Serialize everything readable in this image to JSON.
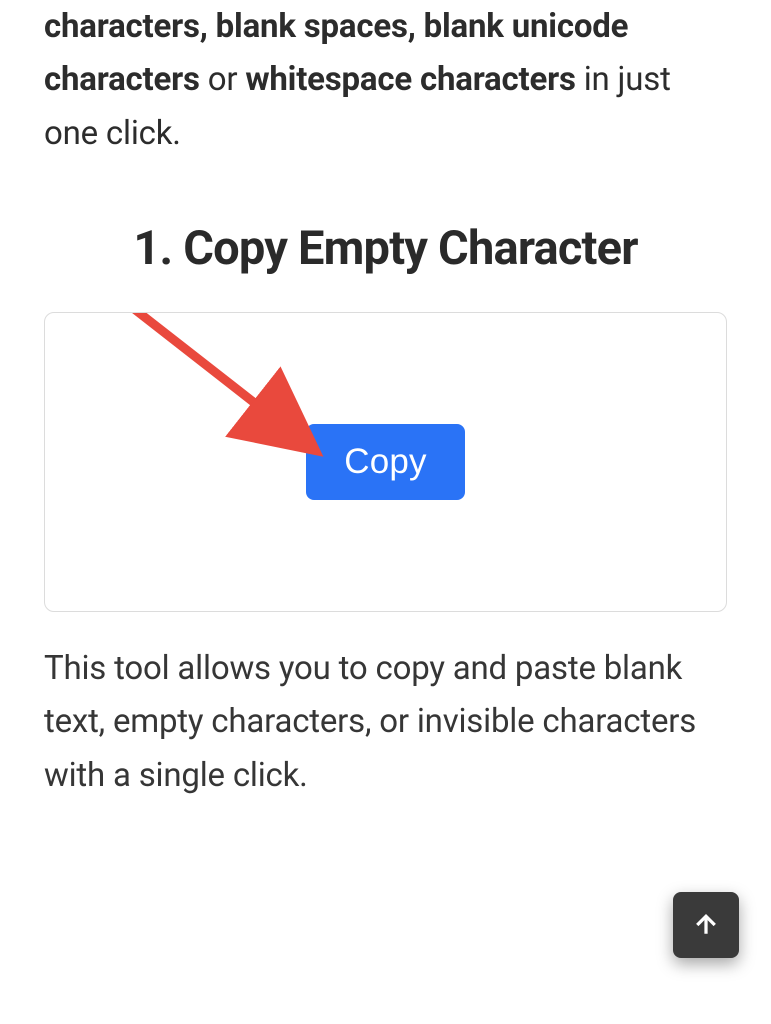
{
  "intro": {
    "bold1": "characters, blank spaces, blank unicode characters",
    "or": " or ",
    "bold2": "whitespace characters",
    "tail": " in just one click."
  },
  "section": {
    "heading_number": "1.",
    "heading_title": "Copy Empty Character"
  },
  "copy": {
    "button_label": "Copy"
  },
  "desc": {
    "text": "This tool allows you to copy and paste blank text, empty characters, or invisible characters with a single click."
  },
  "colors": {
    "accent": "#2a73f6",
    "arrow": "#e9493d"
  }
}
